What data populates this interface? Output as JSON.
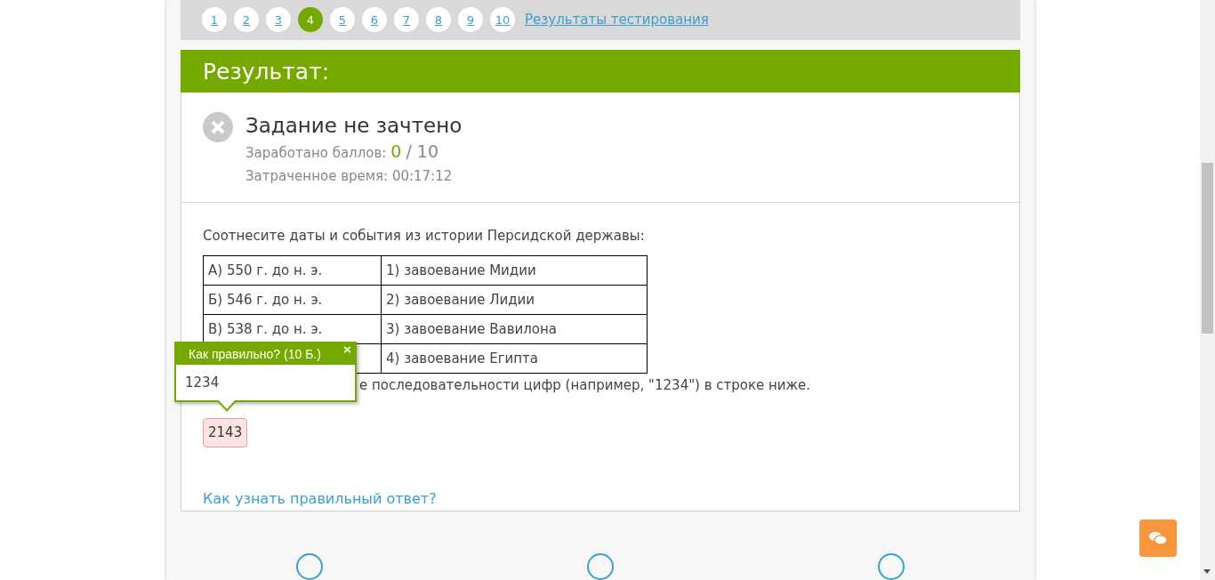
{
  "pagination": {
    "pages": [
      {
        "label": "1",
        "selected": false
      },
      {
        "label": "2",
        "selected": false
      },
      {
        "label": "3",
        "selected": false
      },
      {
        "label": "4",
        "selected": true
      },
      {
        "label": "5",
        "selected": false
      },
      {
        "label": "6",
        "selected": false
      },
      {
        "label": "7",
        "selected": false
      },
      {
        "label": "8",
        "selected": false
      },
      {
        "label": "9",
        "selected": false
      },
      {
        "label": "10",
        "selected": false
      }
    ],
    "results_link": "Результаты тестирования"
  },
  "result": {
    "heading": "Результат:",
    "passed": false,
    "status": "Задание не зачтено",
    "points_label": "Заработано баллов:",
    "points_earned": "0",
    "points_total": "/ 10",
    "time": "Затраченное время: 00:17:12"
  },
  "question": {
    "prompt": "Соотнесите даты и события из истории Персидской державы:",
    "rows": [
      [
        "А) 550 г. до н. э.",
        "1) завоевание Мидии"
      ],
      [
        "Б) 546 г. до н. э.",
        "2) завоевание Лидии"
      ],
      [
        "В) 538 г. до н. э.",
        "3) завоевание Вавилона"
      ],
      [
        "",
        "4) завоевание Египта"
      ]
    ],
    "instruction": "е последовательности цифр (например, \"1234\") в строке ниже.",
    "answer": "2143",
    "answer_correct": false,
    "tooltip": {
      "title": "Как правильно? (10 Б.)",
      "close": "×",
      "value": "1234"
    },
    "help_link": "Как узнать правильный ответ?"
  }
}
